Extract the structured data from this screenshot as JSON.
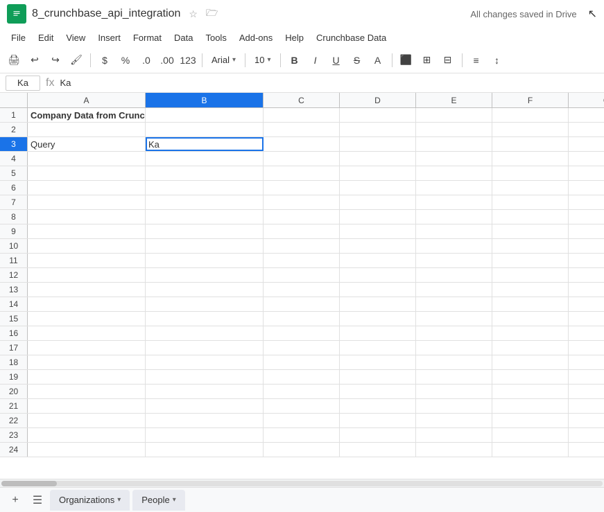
{
  "title": {
    "text": "8_crunchbase_api_integration",
    "star": "☆",
    "folder": "🗁",
    "save_status": "All changes saved in Drive"
  },
  "menu": {
    "items": [
      "File",
      "Edit",
      "View",
      "Insert",
      "Format",
      "Data",
      "Tools",
      "Add-ons",
      "Help",
      "Crunchbase Data"
    ]
  },
  "toolbar": {
    "font_name": "Arial",
    "font_size": "10",
    "format_symbols": [
      "$",
      "%",
      ".0",
      ".00",
      "123"
    ]
  },
  "formula_bar": {
    "cell_ref": "Ka",
    "formula_value": "Ka"
  },
  "columns": {
    "headers": [
      "A",
      "B",
      "C",
      "D",
      "E",
      "F",
      "G"
    ]
  },
  "rows": [
    {
      "num": 1,
      "cells": [
        "Company Data from Crunchbase API",
        "",
        "",
        "",
        "",
        "",
        ""
      ]
    },
    {
      "num": 2,
      "cells": [
        "",
        "",
        "",
        "",
        "",
        "",
        ""
      ]
    },
    {
      "num": 3,
      "cells": [
        "Query",
        "Ka",
        "",
        "",
        "",
        "",
        ""
      ]
    },
    {
      "num": 4,
      "cells": [
        "",
        "",
        "",
        "",
        "",
        "",
        ""
      ]
    },
    {
      "num": 5,
      "cells": [
        "",
        "",
        "",
        "",
        "",
        "",
        ""
      ]
    },
    {
      "num": 6,
      "cells": [
        "",
        "",
        "",
        "",
        "",
        "",
        ""
      ]
    },
    {
      "num": 7,
      "cells": [
        "",
        "",
        "",
        "",
        "",
        "",
        ""
      ]
    },
    {
      "num": 8,
      "cells": [
        "",
        "",
        "",
        "",
        "",
        "",
        ""
      ]
    },
    {
      "num": 9,
      "cells": [
        "",
        "",
        "",
        "",
        "",
        "",
        ""
      ]
    },
    {
      "num": 10,
      "cells": [
        "",
        "",
        "",
        "",
        "",
        "",
        ""
      ]
    },
    {
      "num": 11,
      "cells": [
        "",
        "",
        "",
        "",
        "",
        "",
        ""
      ]
    },
    {
      "num": 12,
      "cells": [
        "",
        "",
        "",
        "",
        "",
        "",
        ""
      ]
    },
    {
      "num": 13,
      "cells": [
        "",
        "",
        "",
        "",
        "",
        "",
        ""
      ]
    },
    {
      "num": 14,
      "cells": [
        "",
        "",
        "",
        "",
        "",
        "",
        ""
      ]
    },
    {
      "num": 15,
      "cells": [
        "",
        "",
        "",
        "",
        "",
        "",
        ""
      ]
    },
    {
      "num": 16,
      "cells": [
        "",
        "",
        "",
        "",
        "",
        "",
        ""
      ]
    },
    {
      "num": 17,
      "cells": [
        "",
        "",
        "",
        "",
        "",
        "",
        ""
      ]
    },
    {
      "num": 18,
      "cells": [
        "",
        "",
        "",
        "",
        "",
        "",
        ""
      ]
    },
    {
      "num": 19,
      "cells": [
        "",
        "",
        "",
        "",
        "",
        "",
        ""
      ]
    },
    {
      "num": 20,
      "cells": [
        "",
        "",
        "",
        "",
        "",
        "",
        ""
      ]
    },
    {
      "num": 21,
      "cells": [
        "",
        "",
        "",
        "",
        "",
        "",
        ""
      ]
    },
    {
      "num": 22,
      "cells": [
        "",
        "",
        "",
        "",
        "",
        "",
        ""
      ]
    },
    {
      "num": 23,
      "cells": [
        "",
        "",
        "",
        "",
        "",
        "",
        ""
      ]
    },
    {
      "num": 24,
      "cells": [
        "",
        "",
        "",
        "",
        "",
        "",
        ""
      ]
    }
  ],
  "sheets": [
    {
      "name": "Organizations",
      "active": false
    },
    {
      "name": "People",
      "active": false
    }
  ],
  "colors": {
    "active_cell_border": "#1a73e8",
    "header_bg": "#f8f9fa",
    "sheet_active_bg": "#ffffff",
    "app_green": "#0f9d58"
  }
}
